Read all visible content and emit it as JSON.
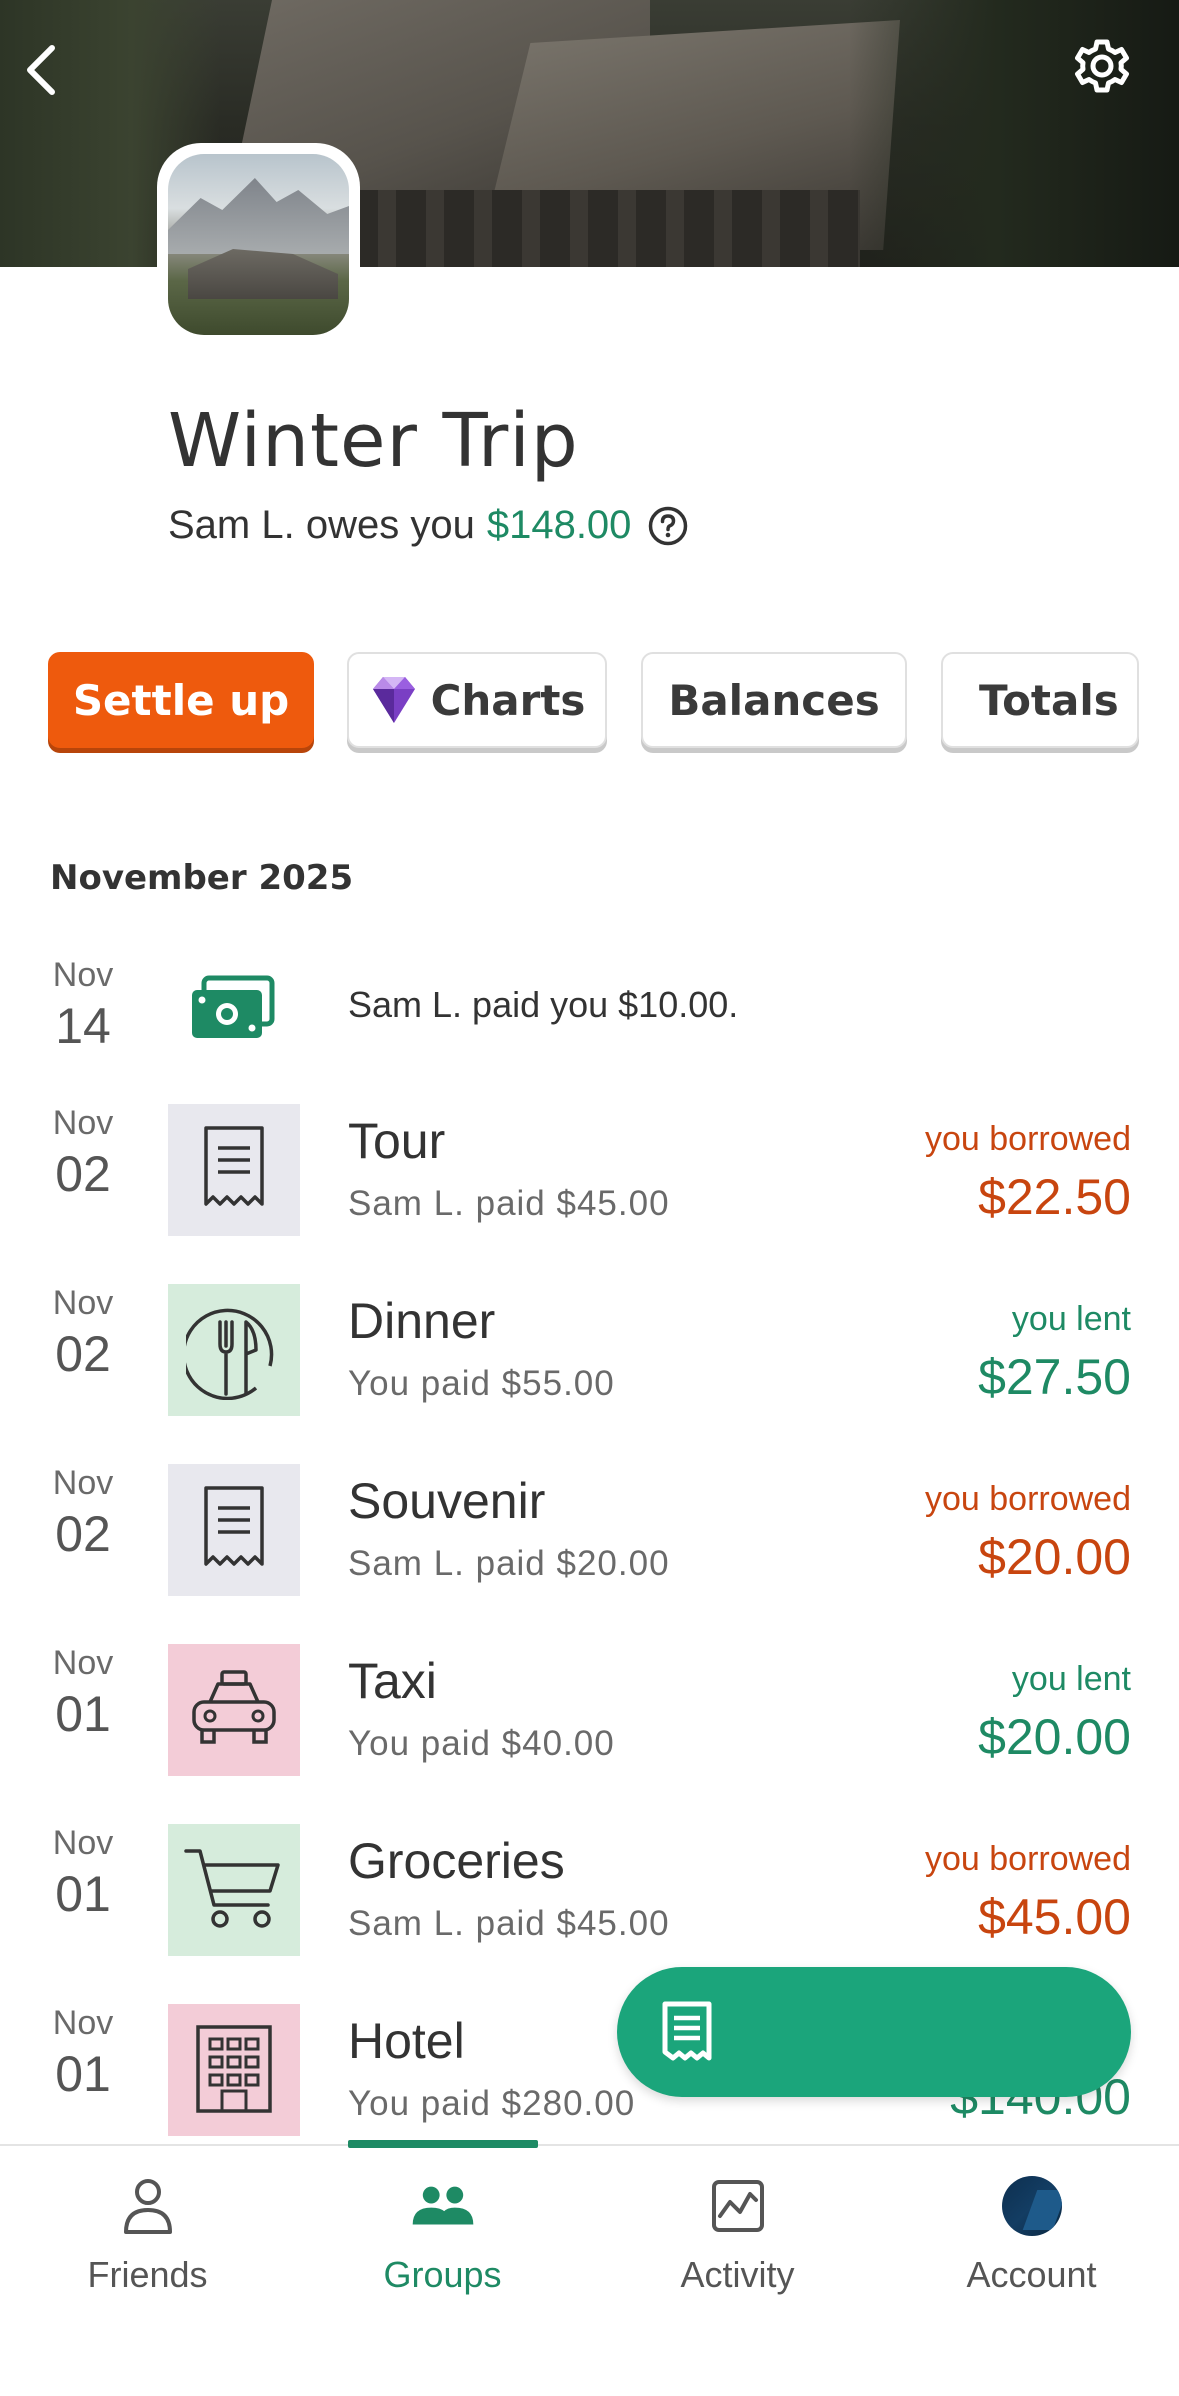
{
  "header": {
    "title": "Winter Trip",
    "balance_prefix": "Sam L. owes you",
    "balance_amount": "$148.00"
  },
  "actions": {
    "settle_up": "Settle up",
    "charts": "Charts",
    "balances": "Balances",
    "totals": "Totals"
  },
  "month_label": "November 2025",
  "payment": {
    "month": "Nov",
    "day": "14",
    "text": "Sam L. paid you $10.00."
  },
  "expenses": [
    {
      "month": "Nov",
      "day": "02",
      "title": "Tour",
      "sub": "Sam L. paid $45.00",
      "status": "you borrowed",
      "amount": "$22.50",
      "icon": "receipt-icon",
      "tile_color": "#e8e8ee",
      "type": "neg"
    },
    {
      "month": "Nov",
      "day": "02",
      "title": "Dinner",
      "sub": "You paid $55.00",
      "status": "you lent",
      "amount": "$27.50",
      "icon": "dining-icon",
      "tile_color": "#d6ecdc",
      "type": "pos"
    },
    {
      "month": "Nov",
      "day": "02",
      "title": "Souvenir",
      "sub": "Sam L. paid $20.00",
      "status": "you borrowed",
      "amount": "$20.00",
      "icon": "receipt-icon",
      "tile_color": "#e8e8ee",
      "type": "neg"
    },
    {
      "month": "Nov",
      "day": "01",
      "title": "Taxi",
      "sub": "You paid $40.00",
      "status": "you lent",
      "amount": "$20.00",
      "icon": "taxi-icon",
      "tile_color": "#f3ccd7",
      "type": "pos"
    },
    {
      "month": "Nov",
      "day": "01",
      "title": "Groceries",
      "sub": "Sam L. paid $45.00",
      "status": "you borrowed",
      "amount": "$45.00",
      "icon": "cart-icon",
      "tile_color": "#d6ecdc",
      "type": "neg"
    },
    {
      "month": "Nov",
      "day": "01",
      "title": "Hotel",
      "sub": "You paid $280.00",
      "status": "",
      "amount": "$140.00",
      "icon": "hotel-icon",
      "tile_color": "#f3ccd7",
      "type": "pos"
    }
  ],
  "tabs": {
    "friends": "Friends",
    "groups": "Groups",
    "activity": "Activity",
    "account": "Account"
  },
  "colors": {
    "accent_green": "#1e8a64",
    "fab_green": "#1ba57b",
    "settle_orange": "#ee5a0d",
    "borrow_orange": "#c8450f"
  }
}
